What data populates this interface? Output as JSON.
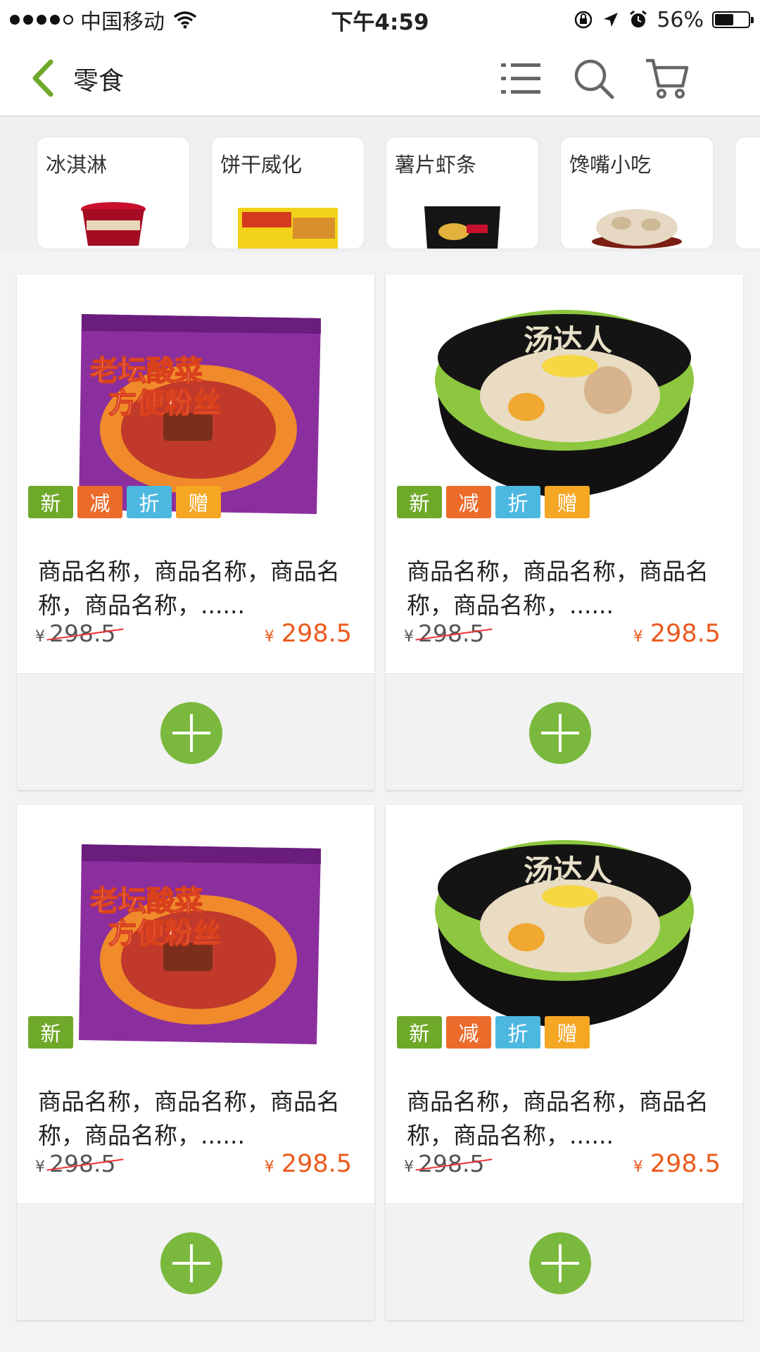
{
  "status_bar": {
    "carrier": "中国移动",
    "time": "下午4:59",
    "battery": "56%",
    "battery_level": 0.56,
    "icons": [
      "signal-dots-icon",
      "wifi-icon",
      "orientation-lock-icon",
      "location-icon",
      "alarm-icon",
      "battery-icon"
    ]
  },
  "nav": {
    "title": "零食",
    "icons": [
      "back-icon",
      "list-icon",
      "search-icon",
      "cart-icon"
    ]
  },
  "categories": [
    {
      "label": "冰淇淋"
    },
    {
      "label": "饼干威化"
    },
    {
      "label": "薯片虾条"
    },
    {
      "label": "馋嘴小吃"
    }
  ],
  "tags": {
    "new": "新",
    "sub": "减",
    "disc": "折",
    "gift": "赠"
  },
  "products": [
    {
      "name": "商品名称，商品名称，商品名称，商品名称，......",
      "currency": "¥",
      "original_price": "298.5",
      "price": "298.5"
    },
    {
      "name": "商品名称，商品名称，商品名称，商品名称，......",
      "currency": "¥",
      "original_price": "298.5",
      "price": "298.5"
    },
    {
      "name": "商品名称，商品名称，商品名称，商品名称，......",
      "currency": "¥",
      "original_price": "298.5",
      "price": "298.5"
    },
    {
      "name": "商品名称，商品名称，商品名称，商品名称，......",
      "currency": "¥",
      "original_price": "298.5",
      "price": "298.5"
    }
  ],
  "colors": {
    "accent_green": "#7ab93d",
    "price_orange": "#eb5a1e",
    "tag_new": "#6fa92a",
    "tag_sub": "#eb6b2b",
    "tag_disc": "#4cb8e0",
    "tag_gift": "#f5a623"
  }
}
